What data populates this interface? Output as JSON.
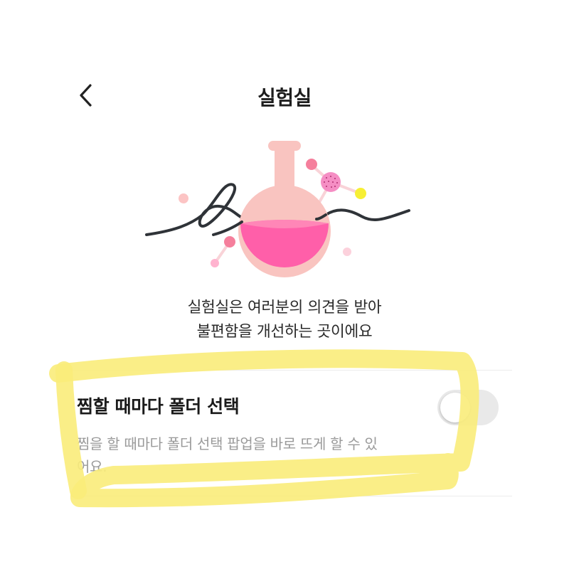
{
  "header": {
    "title": "실험실",
    "back_icon": "chevron-left-icon"
  },
  "intro": {
    "line1": "실험실은 여러분의 의견을 받아",
    "line2": "불편함을 개선하는 곳이에요"
  },
  "illustration": {
    "icon": "lab-flask-illustration",
    "colors": {
      "flask": "#f9c4c0",
      "liquid": "#ff5fa9",
      "line": "#2f3338",
      "yellow": "#f7ef34",
      "pink_dot": "#ffb3cf"
    }
  },
  "setting": {
    "title": "찜할 때마다 폴더 선택",
    "description": "찜을 할 때마다 폴더 선택 팝업을 바로 뜨게 할 수 있어요.",
    "toggle_on": false
  },
  "colors": {
    "highlight": "#f9ec7a",
    "toggle_off": "#e9e9e9"
  }
}
